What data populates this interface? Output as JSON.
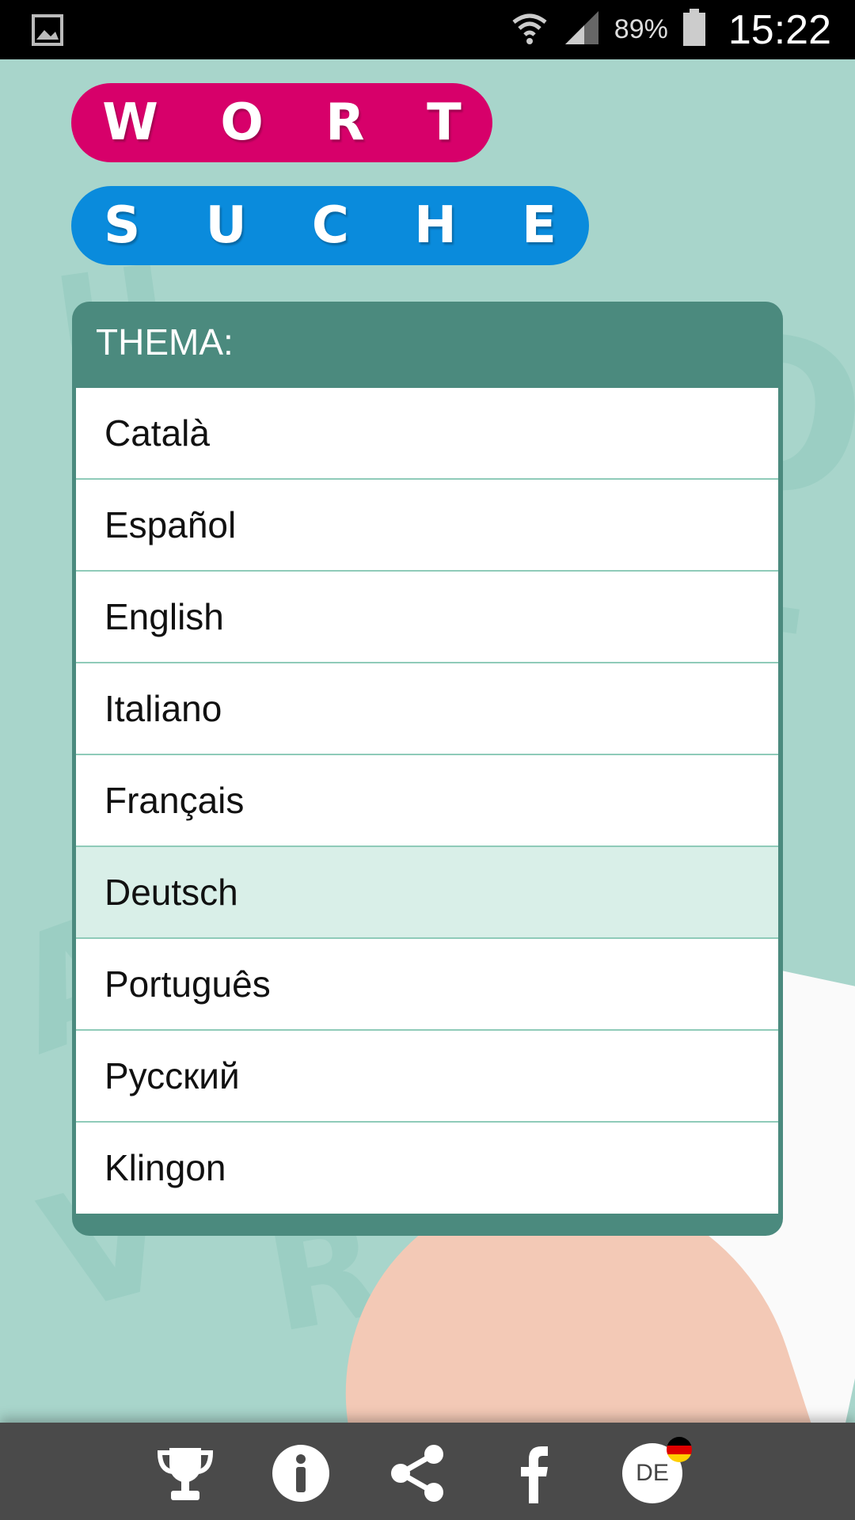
{
  "status_bar": {
    "battery": "89%",
    "time": "15:22"
  },
  "title": {
    "word1": [
      "W",
      "O",
      "R",
      "T"
    ],
    "word2": [
      "S",
      "U",
      "C",
      "H",
      "E"
    ]
  },
  "panel": {
    "title": "THEMA:",
    "items": [
      {
        "label": "Català",
        "selected": false
      },
      {
        "label": "Español",
        "selected": false
      },
      {
        "label": "English",
        "selected": false
      },
      {
        "label": "Italiano",
        "selected": false
      },
      {
        "label": "Français",
        "selected": false
      },
      {
        "label": "Deutsch",
        "selected": true
      },
      {
        "label": "Português",
        "selected": false
      },
      {
        "label": "Русский",
        "selected": false
      },
      {
        "label": "Klingon",
        "selected": false
      }
    ]
  },
  "bottom_bar": {
    "icons": [
      "trophy-icon",
      "info-icon",
      "share-icon",
      "facebook-icon",
      "language-icon"
    ],
    "language_code": "DE"
  },
  "colors": {
    "accent_pink": "#d7006a",
    "accent_blue": "#0a8bdc",
    "panel": "#4b8a7e",
    "background": "#a8d5cb",
    "selected_row": "#d9efe8"
  }
}
